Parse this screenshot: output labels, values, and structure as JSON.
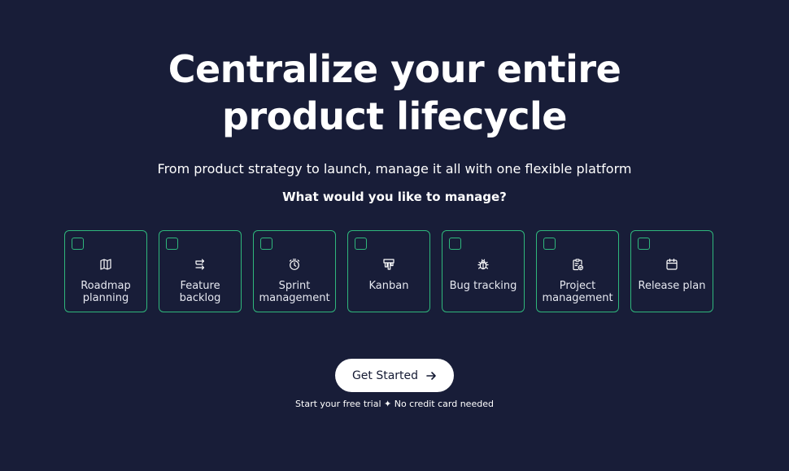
{
  "hero": {
    "headline_line1": "Centralize your entire",
    "headline_line2": "product lifecycle",
    "subtitle": "From product strategy to launch, manage it all with one flexible platform",
    "question": "What would you like to manage?"
  },
  "options": [
    {
      "label": "Roadmap\nplanning",
      "icon": "map-icon"
    },
    {
      "label": "Feature\nbacklog",
      "icon": "backlog-arrows-icon"
    },
    {
      "label": "Sprint\nmanagement",
      "icon": "stopwatch-icon"
    },
    {
      "label": "Kanban",
      "icon": "kanban-board-icon"
    },
    {
      "label": "Bug tracking",
      "icon": "bug-icon"
    },
    {
      "label": "Project\nmanagement",
      "icon": "clipboard-check-icon"
    },
    {
      "label": "Release plan",
      "icon": "calendar-icon"
    }
  ],
  "cta": {
    "label": "Get Started",
    "icon": "arrow-right-icon"
  },
  "trial_note": "Start your free trial ✦ No credit card needed",
  "colors": {
    "background": "#181d38",
    "accent_border": "#2fb77c",
    "button_bg": "#ffffff",
    "button_text": "#141a33"
  }
}
